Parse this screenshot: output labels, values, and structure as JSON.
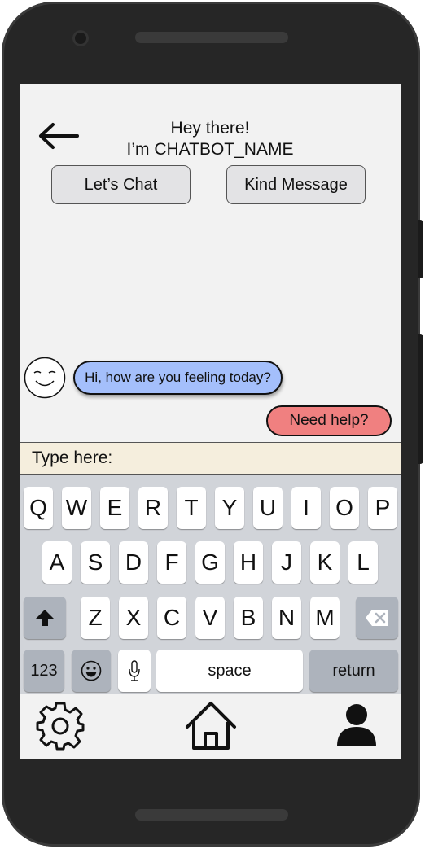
{
  "header": {
    "greeting_line1": "Hey there!",
    "greeting_line2": "I’m CHATBOT_NAME"
  },
  "actions": {
    "lets_chat": "Let’s Chat",
    "kind_message": "Kind Message"
  },
  "chat": {
    "bot_message": "Hi, how are you feeling today?",
    "user_message": "Need help?"
  },
  "input": {
    "placeholder": "Type here:"
  },
  "keyboard": {
    "row1": [
      "Q",
      "W",
      "E",
      "R",
      "T",
      "Y",
      "U",
      "I",
      "O",
      "P"
    ],
    "row2": [
      "A",
      "S",
      "D",
      "F",
      "G",
      "H",
      "J",
      "K",
      "L"
    ],
    "row3": [
      "Z",
      "X",
      "C",
      "V",
      "B",
      "N",
      "M"
    ],
    "numbers_label": "123",
    "space_label": "space",
    "return_label": "return"
  },
  "nav": {
    "left": "settings-icon",
    "center": "home-icon",
    "right": "profile-icon"
  },
  "colors": {
    "bot_bubble": "#a4bffb",
    "user_bubble": "#f08080",
    "input_bar": "#f5eedd",
    "keyboard_bg": "#d1d4d9"
  }
}
